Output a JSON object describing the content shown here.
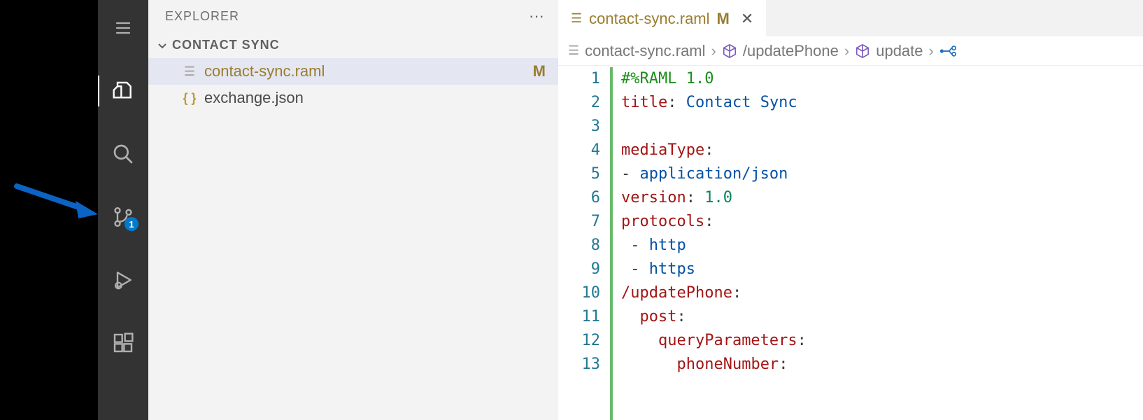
{
  "sidebar": {
    "title": "EXPLORER",
    "section": "CONTACT SYNC",
    "files": [
      {
        "name": "contact-sync.raml",
        "status": "M",
        "selected": true,
        "icon": "raml"
      },
      {
        "name": "exchange.json",
        "status": "",
        "selected": false,
        "icon": "json"
      }
    ]
  },
  "activity": {
    "scm_badge": "1"
  },
  "tab": {
    "filename": "contact-sync.raml",
    "modified_marker": "M"
  },
  "breadcrumbs": {
    "items": [
      "contact-sync.raml",
      "/updatePhone",
      "update"
    ]
  },
  "code": {
    "lines": [
      {
        "n": 1,
        "segs": [
          {
            "t": "#%RAML 1.0",
            "c": "tok-directive"
          }
        ]
      },
      {
        "n": 2,
        "segs": [
          {
            "t": "title",
            "c": "tok-key"
          },
          {
            "t": ": ",
            "c": "tok-punc"
          },
          {
            "t": "Contact Sync",
            "c": "tok-str"
          }
        ]
      },
      {
        "n": 3,
        "segs": [
          {
            "t": "",
            "c": ""
          }
        ]
      },
      {
        "n": 4,
        "segs": [
          {
            "t": "mediaType",
            "c": "tok-key"
          },
          {
            "t": ":",
            "c": "tok-punc"
          }
        ]
      },
      {
        "n": 5,
        "segs": [
          {
            "t": "- ",
            "c": "tok-punc"
          },
          {
            "t": "application/json",
            "c": "tok-str"
          }
        ]
      },
      {
        "n": 6,
        "segs": [
          {
            "t": "version",
            "c": "tok-key"
          },
          {
            "t": ": ",
            "c": "tok-punc"
          },
          {
            "t": "1.0",
            "c": "tok-num"
          }
        ]
      },
      {
        "n": 7,
        "segs": [
          {
            "t": "protocols",
            "c": "tok-key"
          },
          {
            "t": ":",
            "c": "tok-punc"
          }
        ]
      },
      {
        "n": 8,
        "segs": [
          {
            "t": " ",
            "c": "guide"
          },
          {
            "t": "- ",
            "c": "tok-punc"
          },
          {
            "t": "http",
            "c": "tok-str"
          }
        ]
      },
      {
        "n": 9,
        "segs": [
          {
            "t": " ",
            "c": "guide"
          },
          {
            "t": "- ",
            "c": "tok-punc"
          },
          {
            "t": "https",
            "c": "tok-str"
          }
        ]
      },
      {
        "n": 10,
        "segs": [
          {
            "t": "/updatePhone",
            "c": "tok-key"
          },
          {
            "t": ":",
            "c": "tok-punc"
          }
        ]
      },
      {
        "n": 11,
        "segs": [
          {
            "t": "  ",
            "c": "guide"
          },
          {
            "t": "post",
            "c": "tok-key"
          },
          {
            "t": ":",
            "c": "tok-punc"
          }
        ]
      },
      {
        "n": 12,
        "segs": [
          {
            "t": "    ",
            "c": "guide"
          },
          {
            "t": "queryParameters",
            "c": "tok-key"
          },
          {
            "t": ":",
            "c": "tok-punc"
          }
        ]
      },
      {
        "n": 13,
        "segs": [
          {
            "t": "      ",
            "c": "guide"
          },
          {
            "t": "phoneNumber",
            "c": "tok-key"
          },
          {
            "t": ":",
            "c": "tok-punc"
          }
        ]
      }
    ]
  }
}
